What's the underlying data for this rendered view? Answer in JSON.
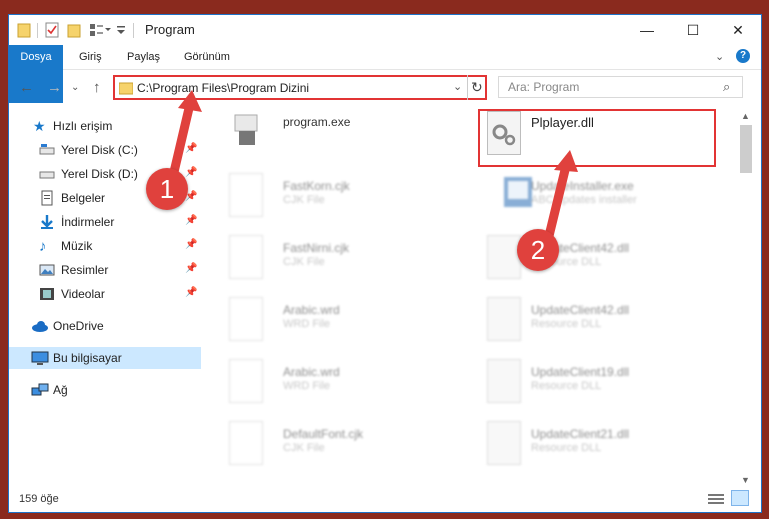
{
  "window": {
    "title": "Program",
    "controls": {
      "minimize": "—",
      "maximize": "☐",
      "close": "✕"
    }
  },
  "ribbon": {
    "tabs": [
      {
        "label": "Dosya"
      },
      {
        "label": "Giriş"
      },
      {
        "label": "Paylaş"
      },
      {
        "label": "Görünüm"
      }
    ]
  },
  "address": {
    "path": "C:\\Program Files\\Program Dizini",
    "search_placeholder": "Ara: Program"
  },
  "nav": {
    "quick_access": "Hızlı erişim",
    "items": [
      {
        "label": "Yerel Disk (C:)",
        "icon": "drive-icon"
      },
      {
        "label": "Yerel Disk (D:)",
        "icon": "drive-icon"
      },
      {
        "label": "Belgeler",
        "icon": "documents-icon"
      },
      {
        "label": "İndirmeler",
        "icon": "downloads-icon"
      },
      {
        "label": "Müzik",
        "icon": "music-icon"
      },
      {
        "label": "Resimler",
        "icon": "pictures-icon"
      },
      {
        "label": "Videolar",
        "icon": "videos-icon"
      }
    ],
    "onedrive": "OneDrive",
    "this_pc": "Bu bilgisayar",
    "network": "Ağ"
  },
  "files": [
    {
      "name": "program.exe",
      "type": ""
    },
    {
      "name": "Plplayer.dll",
      "type": ""
    },
    {
      "name": "FastKorn.cjk",
      "type": "CJK File"
    },
    {
      "name": "UpdateInstaller.exe",
      "type": "ABC updates installer"
    },
    {
      "name": "FastNirni.cjk",
      "type": "CJK File"
    },
    {
      "name": "UpdateClient42.dll",
      "type": "Resource DLL"
    },
    {
      "name": "Arabic.wrd",
      "type": "WRD File"
    },
    {
      "name": "UpdateClient42.dll",
      "type": "Resource DLL"
    },
    {
      "name": "Arabic.wrd",
      "type": "WRD File"
    },
    {
      "name": "UpdateClient19.dll",
      "type": "Resource DLL"
    },
    {
      "name": "DefaultFont.cjk",
      "type": "CJK File"
    },
    {
      "name": "UpdateClient21.dll",
      "type": "Resource DLL"
    }
  ],
  "status": {
    "count": "159 öğe"
  },
  "callouts": {
    "one": "1",
    "two": "2"
  },
  "colors": {
    "accent": "#1979ca",
    "highlight": "#e23434",
    "callout": "#e0413d"
  }
}
